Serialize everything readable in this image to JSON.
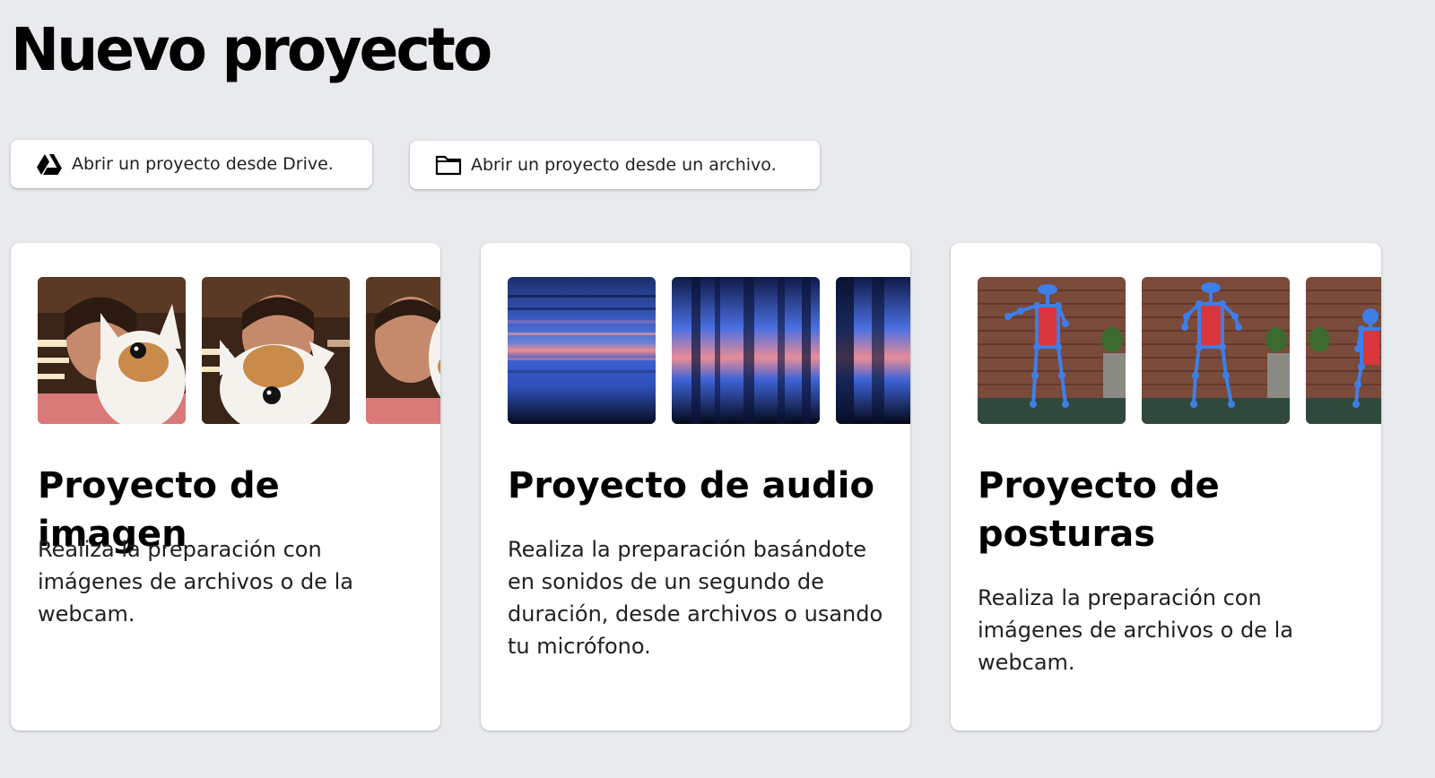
{
  "page": {
    "title": "Nuevo proyecto"
  },
  "open_buttons": {
    "drive": {
      "label": "Abrir un proyecto desde Drive.",
      "icon": "google-drive-icon"
    },
    "file": {
      "label": "Abrir un proyecto desde un archivo.",
      "icon": "folder-icon"
    }
  },
  "cards": [
    {
      "title": "Proyecto de imagen",
      "description": "Realiza la preparación con imágenes de archivos o de la webcam."
    },
    {
      "title": "Proyecto de audio",
      "description": "Realiza la preparación basándote en sonidos de un segundo de duración, desde archivos o usando tu micrófono."
    },
    {
      "title": "Proyecto de posturas",
      "description": "Realiza la preparación con imágenes de archivos o de la webcam."
    }
  ],
  "colors": {
    "background": "#e8eaed",
    "card": "#ffffff",
    "title_text": "#000000",
    "pose_skeleton": "#3f7ee8",
    "spectrogram_low": "#1a2a6c",
    "spectrogram_high": "#f08a8f"
  }
}
